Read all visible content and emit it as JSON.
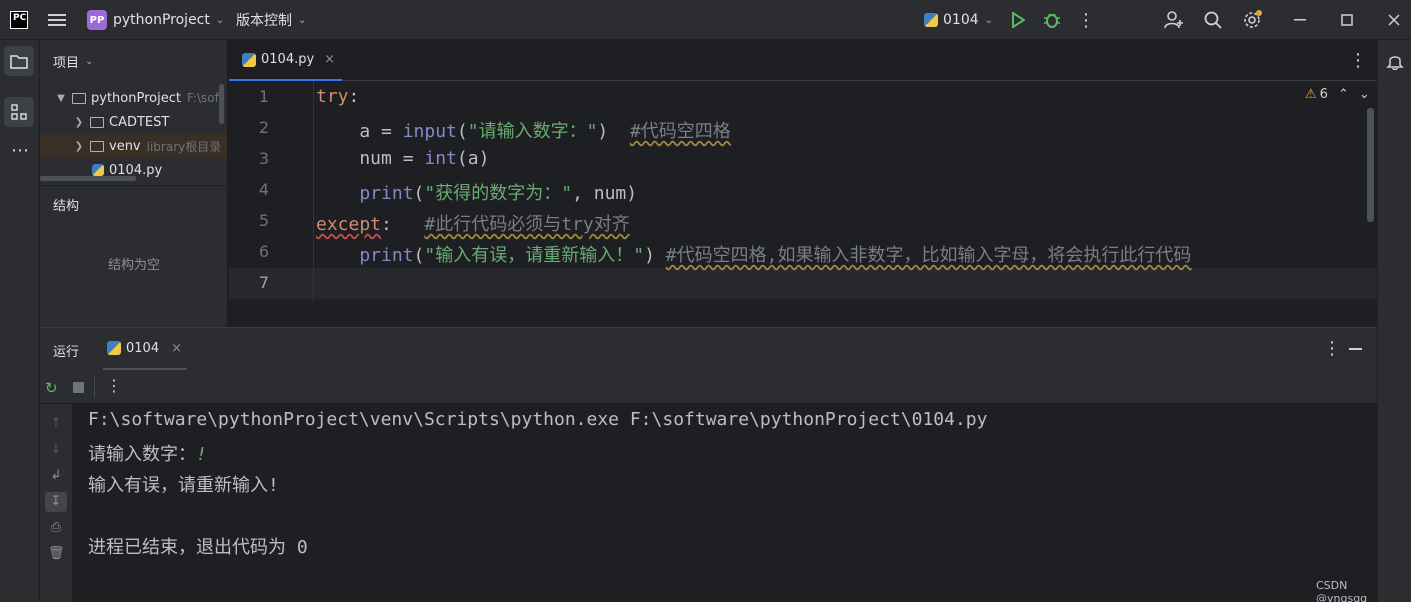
{
  "titlebar": {
    "app_logo": "PC",
    "project_badge": "PP",
    "project_name": "pythonProject",
    "vcs_menu": "版本控制",
    "run_config": "0104"
  },
  "project_panel": {
    "title": "项目",
    "tree": [
      {
        "name": "pythonProject",
        "hint": "F:\\soft",
        "type": "folder",
        "expanded": true
      },
      {
        "name": "CADTEST",
        "hint": "",
        "type": "folder",
        "expanded": false
      },
      {
        "name": "venv",
        "hint": "library根目录",
        "type": "folder",
        "expanded": false
      },
      {
        "name": "0104.py",
        "hint": "",
        "type": "python-file"
      }
    ],
    "structure_title": "结构",
    "structure_empty": "结构为空"
  },
  "editor": {
    "tab_name": "0104.py",
    "warning_count": "6",
    "line_numbers": [
      "1",
      "2",
      "3",
      "4",
      "5",
      "6",
      "7"
    ],
    "lines": {
      "l1_kw": "try",
      "l1_colon": ":",
      "l2_a": "    a = ",
      "l2_fn": "input",
      "l2_p1": "(",
      "l2_str": "\"请输入数字：\"",
      "l2_p2": ")  ",
      "l2_cm": "#代码空四格",
      "l3_a": "    num = ",
      "l3_fn": "int",
      "l3_rest": "(a)",
      "l4_fn": "    print",
      "l4_p1": "(",
      "l4_str": "\"获得的数字为：\"",
      "l4_rest": ", num)",
      "l5_kw": "except",
      "l5_colon": ":   ",
      "l5_cm": "#此行代码必须与try对齐",
      "l6_fn": "    print",
      "l6_p1": "(",
      "l6_str": "\"输入有误，请重新输入！\"",
      "l6_p2": ") ",
      "l6_cm": "#代码空四格,如果输入非数字，比如输入字母，将会执行此行代码"
    }
  },
  "run_panel": {
    "title": "运行",
    "tab_name": "0104",
    "output": [
      "F:\\software\\pythonProject\\venv\\Scripts\\python.exe F:\\software\\pythonProject\\0104.py",
      "请输入数字：",
      "输入有误，请重新输入!",
      "",
      "进程已结束，退出代码为 0"
    ],
    "user_input": "!"
  },
  "watermark": "CSDN @yngsqq",
  "colors": {
    "keyword": "#cf8e6d",
    "builtin": "#8888c6",
    "string": "#6aab73",
    "comment": "#7a7e85",
    "run_green": "#5fb865"
  }
}
